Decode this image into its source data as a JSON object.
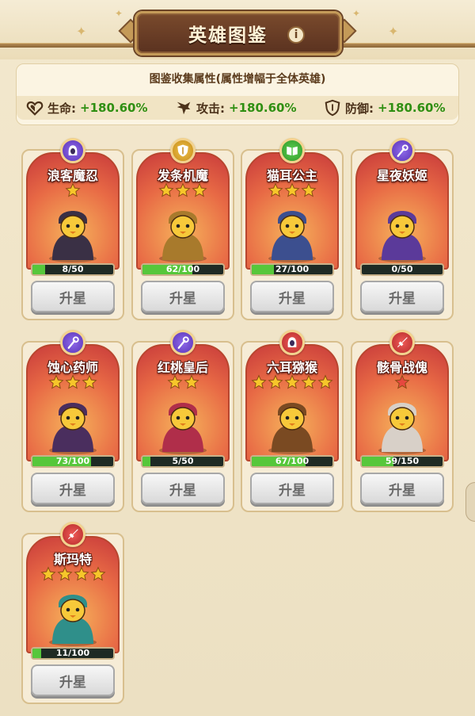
{
  "header": {
    "title": "英雄图鉴",
    "info_icon": "i"
  },
  "stats": {
    "heading": "图鉴收集属性(属性增幅于全体英雄)",
    "items": [
      {
        "icon": "heart-icon",
        "label": "生命:",
        "value": "+180.60%"
      },
      {
        "icon": "attack-wing-icon",
        "label": "攻击:",
        "value": "+180.60%"
      },
      {
        "icon": "shield-icon",
        "label": "防御:",
        "value": "+180.60%"
      }
    ]
  },
  "heroes": [
    {
      "name": "浪客魔忍",
      "emblem": "hood-icon",
      "emblem_color": "purple",
      "stars": 1,
      "progress": "8/50",
      "fill": 0.16,
      "button": "升星",
      "palette": "#3a3045"
    },
    {
      "name": "发条机魔",
      "emblem": "shield-icon",
      "emblem_color": "gold",
      "stars": 3,
      "progress": "62/100",
      "fill": 0.62,
      "button": "升星",
      "palette": "#a87a2c"
    },
    {
      "name": "猫耳公主",
      "emblem": "book-icon",
      "emblem_color": "green",
      "stars": 3,
      "progress": "27/100",
      "fill": 0.27,
      "button": "升星",
      "palette": "#3c4f8f"
    },
    {
      "name": "星夜妖姬",
      "emblem": "staff-icon",
      "emblem_color": "purple",
      "stars": 0,
      "progress": "0/50",
      "fill": 0.0,
      "button": "升星",
      "palette": "#5b3a9a"
    },
    {
      "name": "蚀心药师",
      "emblem": "staff-icon",
      "emblem_color": "purple",
      "stars": 3,
      "progress": "73/100",
      "fill": 0.73,
      "button": "升星",
      "palette": "#4a2e5e"
    },
    {
      "name": "红桃皇后",
      "emblem": "staff-icon",
      "emblem_color": "purple",
      "stars": 2,
      "progress": "5/50",
      "fill": 0.1,
      "button": "升星",
      "palette": "#b02e4a"
    },
    {
      "name": "六耳猕猴",
      "emblem": "hood-icon",
      "emblem_color": "red",
      "stars": 5,
      "progress": "67/100",
      "fill": 0.67,
      "button": "升星",
      "palette": "#7a4a22"
    },
    {
      "name": "骸骨战傀",
      "emblem": "sword-icon",
      "emblem_color": "red",
      "stars": 1,
      "star_color": "red",
      "progress": "59/150",
      "fill": 0.39,
      "button": "升星",
      "palette": "#d8d0c8"
    },
    {
      "name": "斯玛特",
      "emblem": "sword-icon",
      "emblem_color": "red",
      "stars": 4,
      "progress": "11/100",
      "fill": 0.11,
      "button": "升星",
      "palette": "#2f8f8a"
    }
  ]
}
